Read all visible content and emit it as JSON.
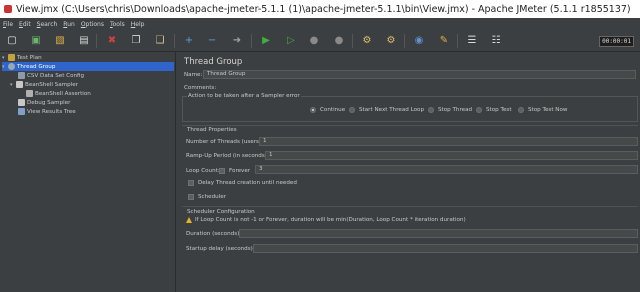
{
  "window": {
    "title": "View.jmx (C:\\Users\\chris\\Downloads\\apache-jmeter-5.1.1 (1)\\apache-jmeter-5.1.1\\bin\\View.jmx) - Apache JMeter (5.1.1 r1855137)"
  },
  "menu": {
    "items": [
      {
        "u": "F",
        "rest": "ile"
      },
      {
        "u": "E",
        "rest": "dit"
      },
      {
        "u": "S",
        "rest": "earch"
      },
      {
        "u": "R",
        "rest": "un"
      },
      {
        "u": "O",
        "rest": "ptions"
      },
      {
        "u": "T",
        "rest": "ools"
      },
      {
        "u": "H",
        "rest": "elp"
      }
    ]
  },
  "toolbar": {
    "icons": [
      "new-icon",
      "templates-icon",
      "open-icon",
      "save-icon",
      "cut-icon",
      "copy-icon",
      "paste-icon",
      "expand-icon",
      "collapse-icon",
      "toggle-icon",
      "start-icon",
      "start-no-pause-icon",
      "stop-icon",
      "shutdown-icon",
      "clear-icon",
      "clear-all-icon",
      "search-icon",
      "reset-search-icon",
      "function-helper-icon",
      "help-icon"
    ],
    "timer": "00:00:01"
  },
  "tree": {
    "items": [
      {
        "label": "Test Plan"
      },
      {
        "label": "Thread Group"
      },
      {
        "label": "CSV Data Set Config"
      },
      {
        "label": "BeanShell Sampler"
      },
      {
        "label": "BeanShell Assertion"
      },
      {
        "label": "Debug Sampler"
      },
      {
        "label": "View Results Tree"
      }
    ]
  },
  "panel": {
    "title": "Thread Group",
    "name_label": "Name:",
    "name_value": "Thread Group",
    "comments_label": "Comments:",
    "error_action": {
      "legend": "Action to be taken after a Sampler error",
      "options": [
        "Continue",
        "Start Next Thread Loop",
        "Stop Thread",
        "Stop Test",
        "Stop Test Now"
      ],
      "selected": "Continue"
    },
    "thread_properties": {
      "heading": "Thread Properties",
      "threads_label": "Number of Threads (users):",
      "threads_value": "1",
      "rampup_label": "Ramp-Up Period (in seconds):",
      "rampup_value": "1",
      "loop_label": "Loop Count:",
      "forever_label": "Forever",
      "loop_value": "3",
      "delay_label": "Delay Thread creation until needed",
      "scheduler_label": "Scheduler"
    },
    "scheduler": {
      "heading": "Scheduler Configuration",
      "warning": "If Loop Count is not -1 or Forever, duration will be min(Duration, Loop Count * iteration duration)",
      "duration_label": "Duration (seconds)",
      "startup_label": "Startup delay (seconds)"
    }
  }
}
